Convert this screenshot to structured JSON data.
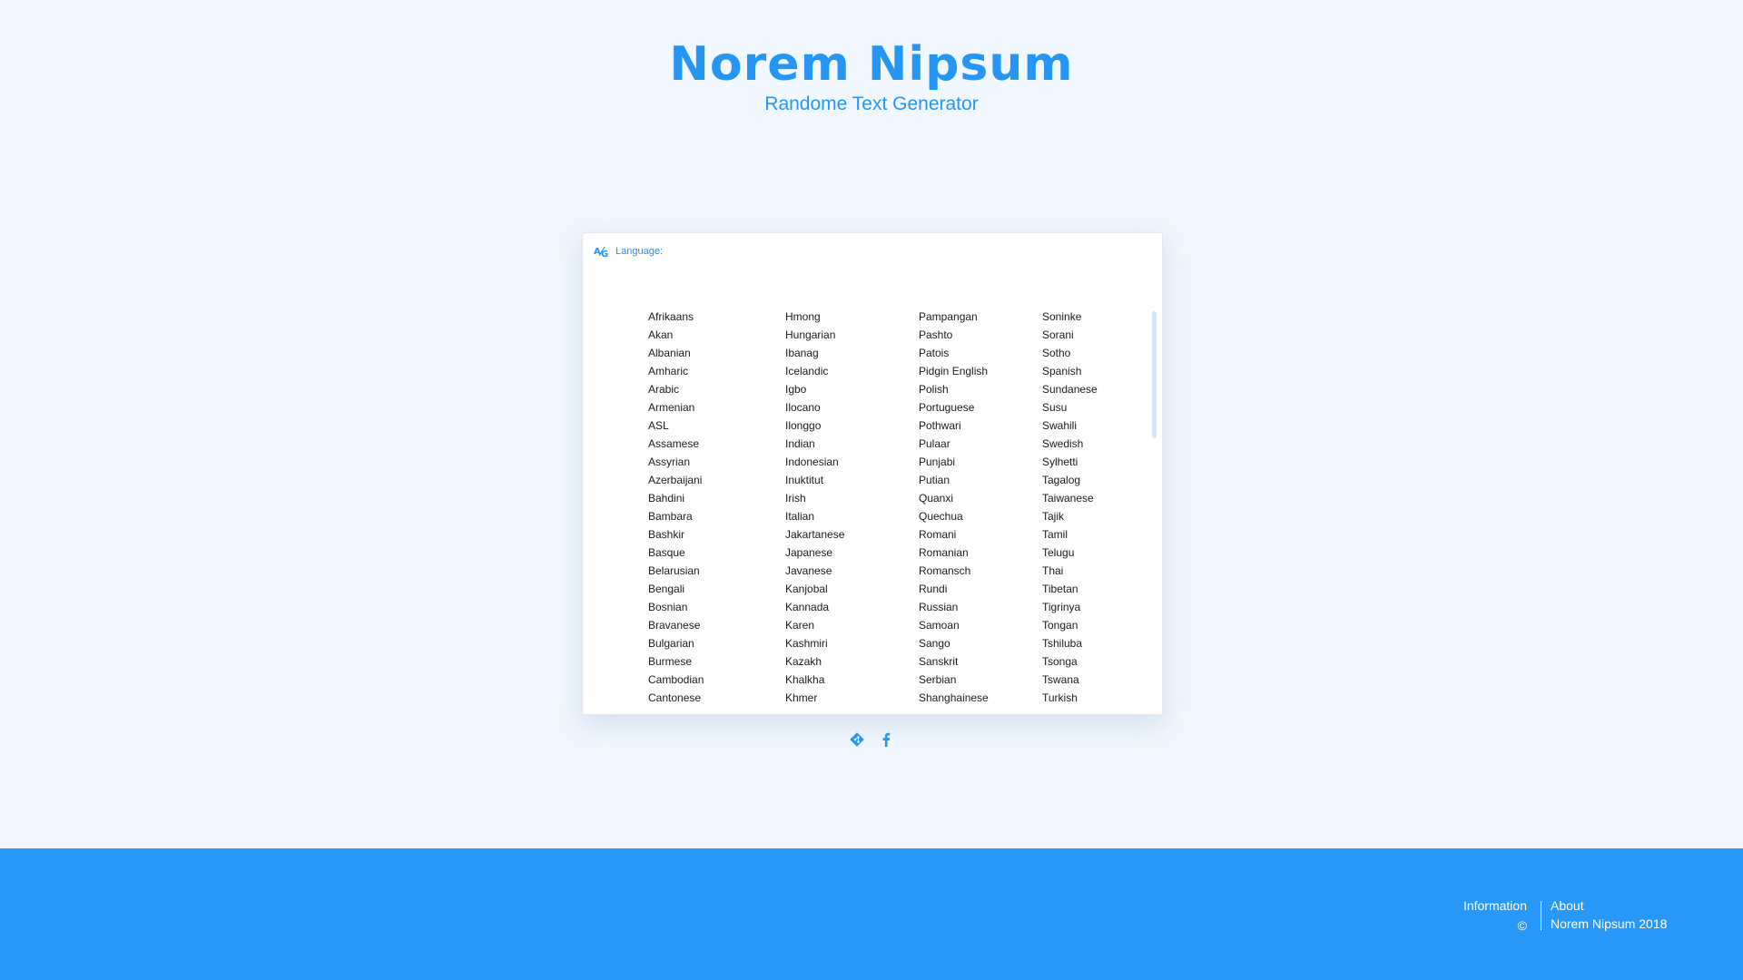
{
  "header": {
    "title": "Norem Nipsum",
    "subtitle": "Randome Text Generator"
  },
  "card": {
    "label": "Language:",
    "label_icon": "translate-icon"
  },
  "languages": {
    "col1": [
      "Afrikaans",
      "Akan",
      "Albanian",
      "Amharic",
      "Arabic",
      "Armenian",
      "ASL",
      "Assamese",
      "Assyrian",
      "Azerbaijani",
      "Bahdini",
      "Bambara",
      "Bashkir",
      "Basque",
      "Belarusian",
      "Bengali",
      "Bosnian",
      "Bravanese",
      "Bulgarian",
      "Burmese",
      "Cambodian",
      "Cantonese"
    ],
    "col2": [
      "Hmong",
      "Hungarian",
      "Ibanag",
      "Icelandic",
      "Igbo",
      "Ilocano",
      "Ilonggo",
      "Indian",
      "Indonesian",
      "Inuktitut",
      "Irish",
      "Italian",
      "Jakartanese",
      "Japanese",
      "Javanese",
      "Kanjobal",
      "Kannada",
      "Karen",
      "Kashmiri",
      "Kazakh",
      "Khalkha",
      "Khmer"
    ],
    "col3": [
      "Pampangan",
      "Pashto",
      "Patois",
      "Pidgin English",
      "Polish",
      "Portuguese",
      "Pothwari",
      "Pulaar",
      "Punjabi",
      "Putian",
      "Quanxi",
      "Quechua",
      "Romani",
      "Romanian",
      "Romansch",
      "Rundi",
      "Russian",
      "Samoan",
      "Sango",
      "Sanskrit",
      "Serbian",
      "Shanghainese"
    ],
    "col4": [
      "Soninke",
      "Sorani",
      "Sotho",
      "Spanish",
      "Sundanese",
      "Susu",
      "Swahili",
      "Swedish",
      "Sylhetti",
      "Tagalog",
      "Taiwanese",
      "Tajik",
      "Tamil",
      "Telugu",
      "Thai",
      "Tibetan",
      "Tigrinya",
      "Tongan",
      "Tshiluba",
      "Tsonga",
      "Tswana",
      "Turkish"
    ]
  },
  "social": {
    "git_icon": "git-icon",
    "facebook_icon": "facebook-icon"
  },
  "footer": {
    "information": "Information",
    "about": "About",
    "copyright_symbol": "©",
    "copyright_text": "Norem Nipsum 2018"
  },
  "colors": {
    "accent": "#2696f5",
    "background": "#f0f7fe",
    "footer": "#2898f9"
  }
}
